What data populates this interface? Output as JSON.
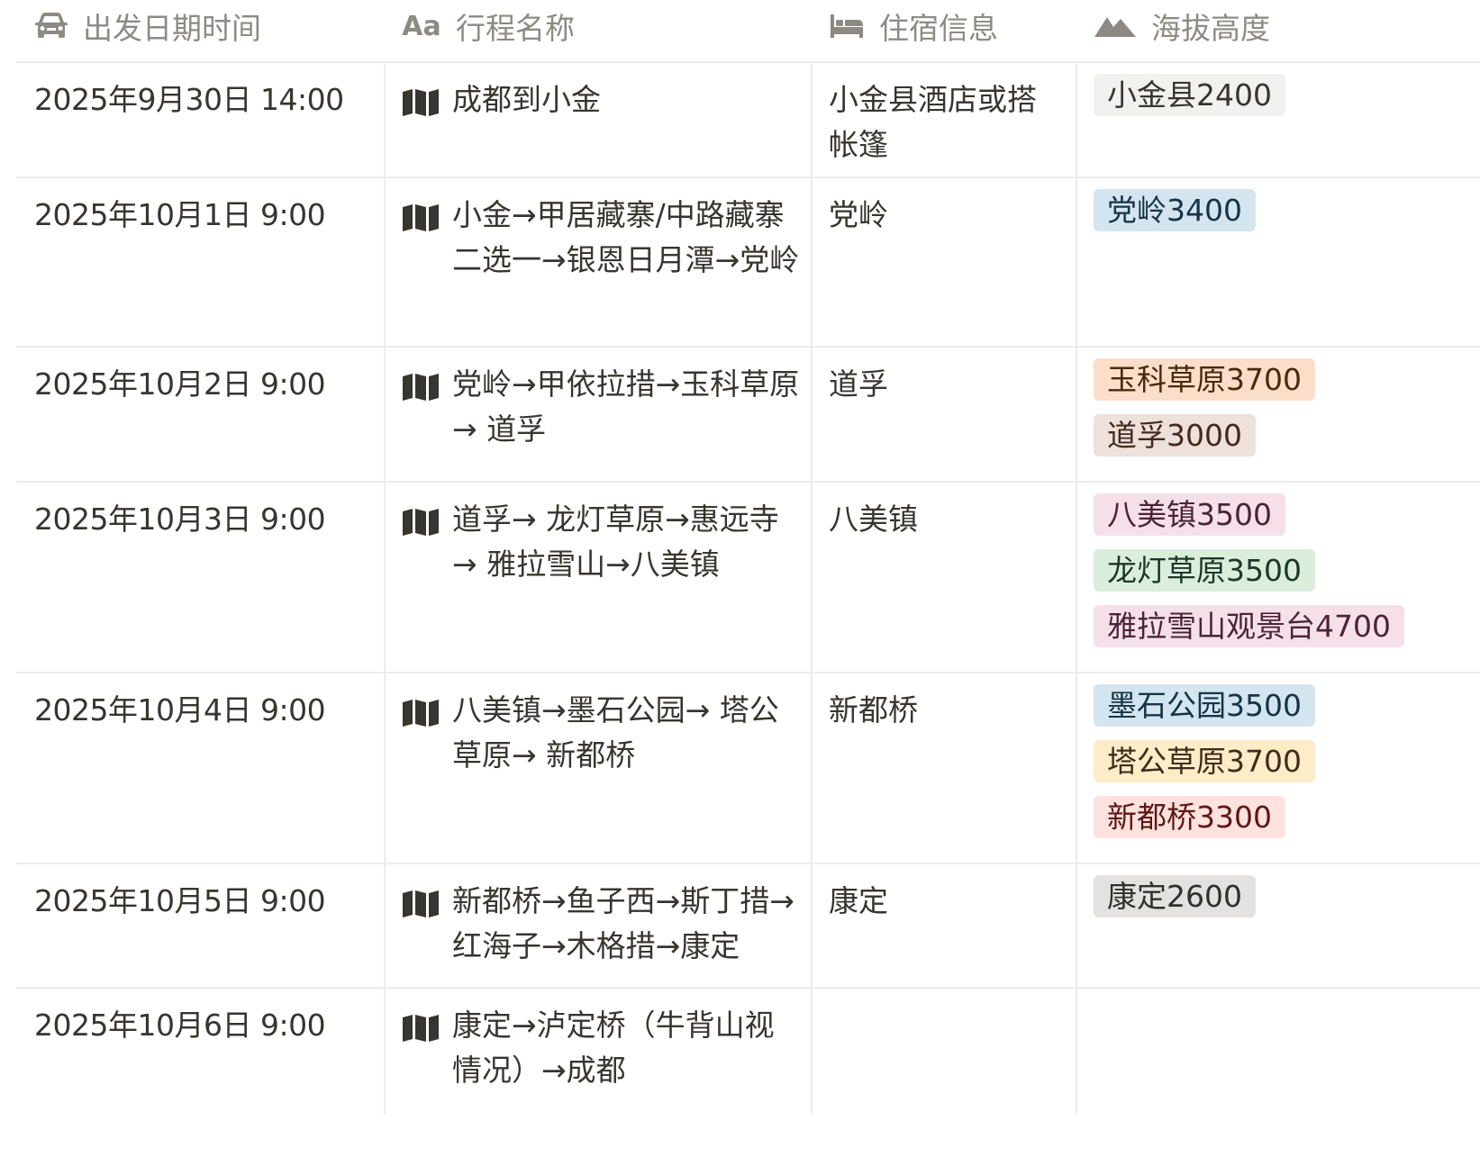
{
  "columns": {
    "date": "出发日期时间",
    "name": "行程名称",
    "stay": "住宿信息",
    "altitude": "海拔高度",
    "name_icon_text": "Aa"
  },
  "icons": {
    "date_header": "car-icon",
    "name_header": "text-aa-icon",
    "stay_header": "bed-icon",
    "altitude_header": "mountain-icon",
    "row_route": "map-icon"
  },
  "colors": {
    "gray": {
      "bg": "#f1f1ef",
      "fg": "#37352f"
    },
    "blue": {
      "bg": "#d3e5ef",
      "fg": "#183347"
    },
    "orange": {
      "bg": "#fadec9",
      "fg": "#49290e"
    },
    "brown": {
      "bg": "#eee0da",
      "fg": "#44291e"
    },
    "pink": {
      "bg": "#f5e0e9",
      "fg": "#4c2337"
    },
    "green": {
      "bg": "#dbeddb",
      "fg": "#1c3829"
    },
    "yellow": {
      "bg": "#fdecc8",
      "fg": "#402c1b"
    },
    "red": {
      "bg": "#ffe2dd",
      "fg": "#5d1715"
    },
    "darkgray": {
      "bg": "#e3e2e0",
      "fg": "#32302c"
    }
  },
  "rows": [
    {
      "date": "2025年9月30日 14:00",
      "name": "成都到小金",
      "stay": "小金县酒店或搭帐篷",
      "altitudes": [
        {
          "label": "小金县2400",
          "color": "gray"
        }
      ]
    },
    {
      "date": "2025年10月1日 9:00",
      "name": "小金→甲居藏寨/中路藏寨二选一→银恩日月潭→党岭",
      "stay": "党岭",
      "altitudes": [
        {
          "label": "党岭3400",
          "color": "blue"
        }
      ]
    },
    {
      "date": "2025年10月2日 9:00",
      "name": "党岭→甲依拉措→玉科草原 → 道孚",
      "stay": "道孚",
      "altitudes": [
        {
          "label": "玉科草原3700",
          "color": "orange"
        },
        {
          "label": "道孚3000",
          "color": "brown"
        }
      ]
    },
    {
      "date": "2025年10月3日 9:00",
      "name": "道孚→ 龙灯草原→惠远寺→ 雅拉雪山→八美镇",
      "stay": "八美镇",
      "altitudes": [
        {
          "label": "八美镇3500",
          "color": "pink"
        },
        {
          "label": "龙灯草原3500",
          "color": "green"
        },
        {
          "label": "雅拉雪山观景台4700",
          "color": "pink"
        }
      ]
    },
    {
      "date": "2025年10月4日 9:00",
      "name": "八美镇→墨石公园→ 塔公草原→ 新都桥",
      "stay": "新都桥",
      "altitudes": [
        {
          "label": "墨石公园3500",
          "color": "blue"
        },
        {
          "label": "塔公草原3700",
          "color": "yellow"
        },
        {
          "label": "新都桥3300",
          "color": "red"
        }
      ]
    },
    {
      "date": "2025年10月5日 9:00",
      "name": "新都桥→鱼子西→斯丁措→红海子→木格措→康定",
      "stay": "康定",
      "altitudes": [
        {
          "label": "康定2600",
          "color": "darkgray"
        }
      ]
    },
    {
      "date": "2025年10月6日 9:00",
      "name": "康定→泸定桥（牛背山视情况）→成都",
      "stay": "",
      "altitudes": []
    }
  ]
}
